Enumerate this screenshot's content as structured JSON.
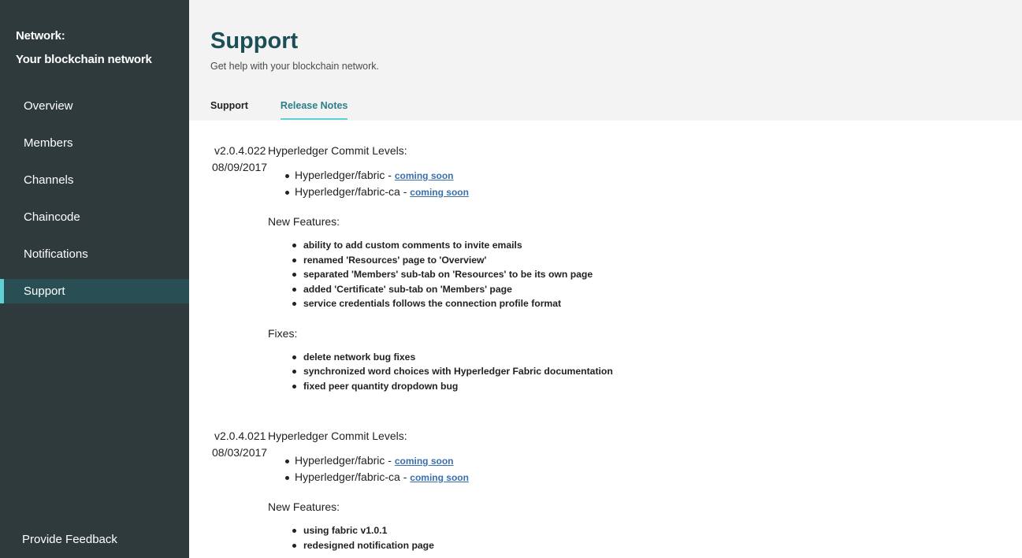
{
  "sidebar": {
    "network_label": "Network:",
    "network_name": "Your blockchain network",
    "items": [
      {
        "label": "Overview"
      },
      {
        "label": "Members"
      },
      {
        "label": "Channels"
      },
      {
        "label": "Chaincode"
      },
      {
        "label": "Notifications"
      },
      {
        "label": "Support"
      }
    ],
    "active": "Support",
    "feedback_label": "Provide Feedback"
  },
  "header": {
    "title": "Support",
    "subtitle": "Get help with your blockchain network.",
    "tabs": [
      {
        "label": "Support"
      },
      {
        "label": "Release Notes"
      }
    ],
    "active_tab": "Release Notes"
  },
  "releases": [
    {
      "version": "v2.0.4.022",
      "date": "08/09/2017",
      "commit_title": "Hyperledger Commit Levels:",
      "commits": [
        {
          "name": "Hyperledger/fabric - ",
          "link": "coming soon"
        },
        {
          "name": "Hyperledger/fabric-ca - ",
          "link": "coming soon"
        }
      ],
      "features_title": "New Features:",
      "features": [
        "ability to add custom comments to invite emails",
        "renamed 'Resources' page to 'Overview'",
        "separated 'Members' sub-tab on 'Resources' to be its own page",
        "added 'Certificate' sub-tab on 'Members' page",
        "service credentials follows the connection profile format"
      ],
      "fixes_title": "Fixes:",
      "fixes": [
        "delete network bug fixes",
        "synchronized word choices with Hyperledger Fabric documentation",
        "fixed peer quantity dropdown bug"
      ]
    },
    {
      "version": "v2.0.4.021",
      "date": "08/03/2017",
      "commit_title": "Hyperledger Commit Levels:",
      "commits": [
        {
          "name": "Hyperledger/fabric - ",
          "link": "coming soon"
        },
        {
          "name": "Hyperledger/fabric-ca - ",
          "link": "coming soon"
        }
      ],
      "features_title": "New Features:",
      "features": [
        "using fabric v1.0.1",
        "redesigned notification page"
      ]
    }
  ],
  "colors": {
    "sidebar_bg": "#2f3a3c",
    "sidebar_active_bg": "#294f54",
    "accent": "#5fd0d6",
    "title": "#1b4f56",
    "link": "#3a6fad"
  }
}
